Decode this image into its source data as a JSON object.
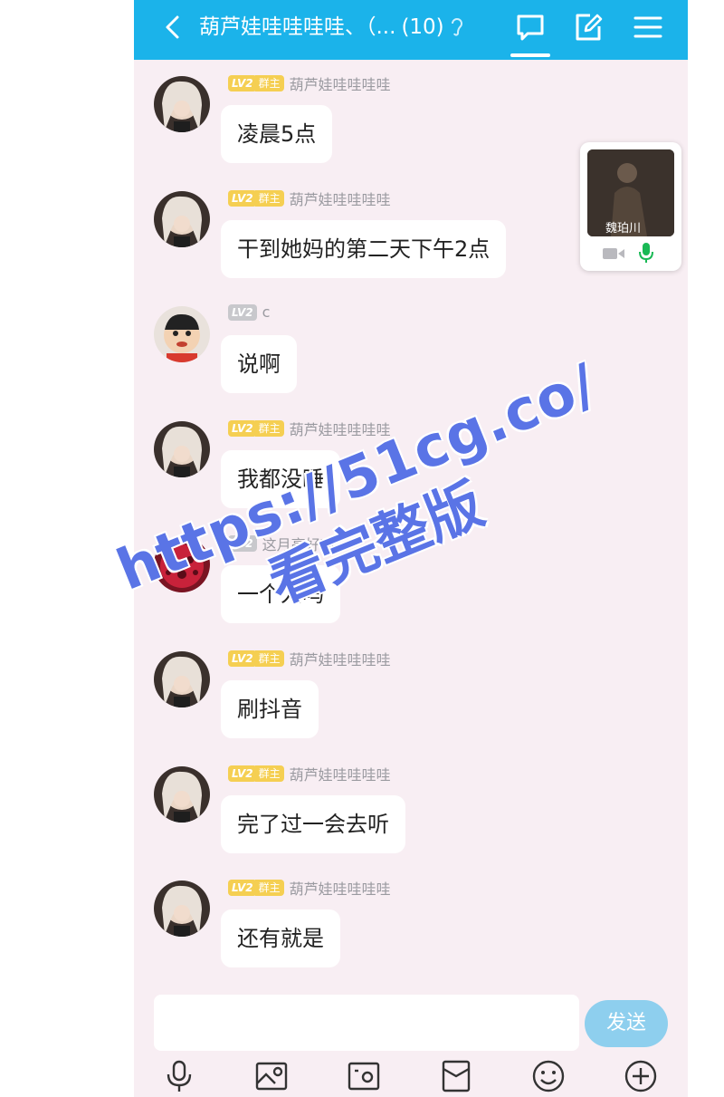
{
  "header": {
    "title": "葫芦娃哇哇哇哇、（...",
    "member_count": "(10)"
  },
  "messages": [
    {
      "level": "LV2",
      "role": "群主",
      "sender": "葫芦娃哇哇哇哇",
      "text": "凌晨5点",
      "avatar": "blonde-girl"
    },
    {
      "level": "LV2",
      "role": "群主",
      "sender": "葫芦娃哇哇哇哇",
      "text": "干到她妈的第二天下午2点",
      "avatar": "blonde-girl"
    },
    {
      "level": "LV2",
      "role": "",
      "sender": "c",
      "text": "说啊",
      "avatar": "cartoon-boy"
    },
    {
      "level": "LV2",
      "role": "群主",
      "sender": "葫芦娃哇哇哇哇",
      "text": "我都没睡",
      "avatar": "blonde-girl"
    },
    {
      "level": "LV2",
      "role": "",
      "sender": "这月亮好高",
      "text": "一个人吗",
      "avatar": "red-ladybug"
    },
    {
      "level": "LV2",
      "role": "群主",
      "sender": "葫芦娃哇哇哇哇",
      "text": "刷抖音",
      "avatar": "blonde-girl"
    },
    {
      "level": "LV2",
      "role": "群主",
      "sender": "葫芦娃哇哇哇哇",
      "text": "完了过一会去听",
      "avatar": "blonde-girl"
    },
    {
      "level": "LV2",
      "role": "群主",
      "sender": "葫芦娃哇哇哇哇",
      "text": "还有就是",
      "avatar": "blonde-girl"
    }
  ],
  "video_call": {
    "name": "魏珀川"
  },
  "input": {
    "send_label": "发送",
    "placeholder": ""
  },
  "toolbar": [
    "mic-icon",
    "image-icon",
    "camera-icon",
    "red-packet-icon",
    "emoji-icon",
    "plus-icon"
  ],
  "watermark": {
    "url": "https://51cg.co/",
    "text": "看完整版"
  },
  "colors": {
    "header": "#1bb3ea",
    "background": "#f8eef3",
    "badge": "#f5cf52",
    "send": "#8ecfee",
    "watermark": "#5a74e6"
  }
}
